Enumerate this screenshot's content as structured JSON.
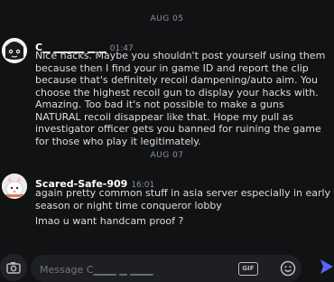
{
  "dividers": {
    "first": "AUG 05",
    "second": "AUG 07"
  },
  "messages": [
    {
      "author": "C▁  ▁▁▁▁ ▁ ▁",
      "time": "01:47",
      "text": "Nice hacks. Maybe you shouldn't post yourself using them because then I find your in game ID and report the clip because that's definitely recoil dampening/auto aim. You choose the highest recoil gun to display your hacks with. Amazing. Too bad it's not possible to make a guns NATURAL recoil disappear like that. Hope my pull as investigator officer gets you banned for ruining the game for those who play it legitimately."
    },
    {
      "author": "Scared-Safe-909",
      "time": "16:01",
      "text": "again pretty common stuff in asia server especially in early season or night time conqueror lobby",
      "text2": "lmao u want handcam proof ?"
    }
  ],
  "composer": {
    "placeholder": "Message C▁▁▁ ▁ ▁▁▁",
    "gif_label": "GIF"
  },
  "icons": {
    "camera": "camera-icon",
    "emoji": "emoji-icon",
    "send": "send-icon"
  }
}
